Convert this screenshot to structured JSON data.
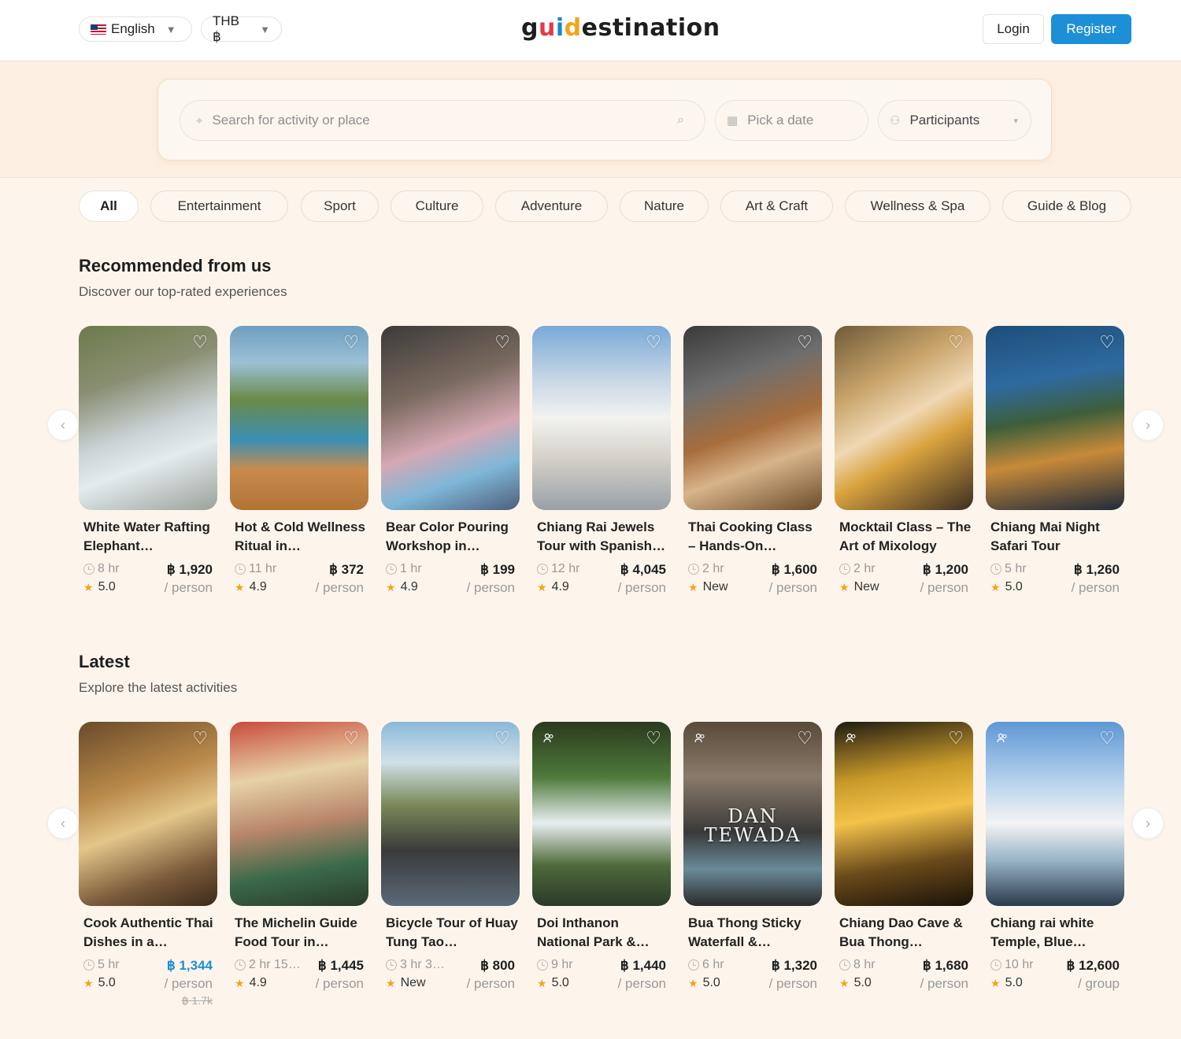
{
  "header": {
    "language": "English",
    "currency": "THB ฿",
    "logo_parts": [
      "g",
      "u",
      "i",
      "d",
      "estination"
    ],
    "login": "Login",
    "register": "Register",
    "brand_color": "#1d8fd6"
  },
  "search": {
    "placeholder": "Search for activity or place",
    "date_placeholder": "Pick a date",
    "participants": "Participants"
  },
  "categories": [
    "All",
    "Entertainment",
    "Sport",
    "Culture",
    "Adventure",
    "Nature",
    "Art & Craft",
    "Wellness & Spa",
    "Guide & Blog"
  ],
  "recommended": {
    "title": "Recommended from us",
    "subtitle": "Discover our top-rated experiences",
    "cards": [
      {
        "title": "White Water Rafting Elephant…",
        "duration": "8 hr",
        "rating": "5.0",
        "price": "฿ 1,920",
        "unit": "/ person"
      },
      {
        "title": "Hot & Cold Wellness Ritual in…",
        "duration": "11 hr",
        "rating": "4.9",
        "price": "฿ 372",
        "unit": "/ person"
      },
      {
        "title": "Bear Color Pouring Workshop in…",
        "duration": "1 hr",
        "rating": "4.9",
        "price": "฿ 199",
        "unit": "/ person"
      },
      {
        "title": "Chiang Rai Jewels Tour with Spanish…",
        "duration": "12 hr",
        "rating": "4.9",
        "price": "฿ 4,045",
        "unit": "/ person"
      },
      {
        "title": "Thai Cooking Class – Hands-On…",
        "duration": "2 hr",
        "rating": "New",
        "price": "฿ 1,600",
        "unit": "/ person"
      },
      {
        "title": "Mocktail Class – The Art of Mixology",
        "duration": "2 hr",
        "rating": "New",
        "price": "฿ 1,200",
        "unit": "/ person"
      },
      {
        "title": "Chiang Mai Night Safari Tour",
        "duration": "5 hr",
        "rating": "5.0",
        "price": "฿ 1,260",
        "unit": "/ person"
      }
    ]
  },
  "latest": {
    "title": "Latest",
    "subtitle": "Explore the latest activities",
    "cards": [
      {
        "title": "Cook Authentic Thai Dishes in a…",
        "duration": "5 hr",
        "rating": "5.0",
        "price": "฿ 1,344",
        "unit": "/ person",
        "old_price": "฿ 1.7k"
      },
      {
        "title": "The Michelin Guide Food Tour in…",
        "duration": "2 hr 15…",
        "rating": "4.9",
        "price": "฿ 1,445",
        "unit": "/ person"
      },
      {
        "title": "Bicycle Tour of Huay Tung Tao…",
        "duration": "3 hr 3…",
        "rating": "New",
        "price": "฿ 800",
        "unit": "/ person"
      },
      {
        "title": "Doi Inthanon National Park &…",
        "duration": "9 hr",
        "rating": "5.0",
        "price": "฿ 1,440",
        "unit": "/ person"
      },
      {
        "title": "Bua Thong Sticky Waterfall &…",
        "duration": "6 hr",
        "rating": "5.0",
        "price": "฿ 1,320",
        "unit": "/ person",
        "image_text": "DAN TEWADA"
      },
      {
        "title": "Chiang Dao Cave & Bua Thong…",
        "duration": "8 hr",
        "rating": "5.0",
        "price": "฿ 1,680",
        "unit": "/ person"
      },
      {
        "title": "Chiang rai white Temple, Blue…",
        "duration": "10 hr",
        "rating": "5.0",
        "price": "฿ 12,600",
        "unit": "/ group"
      }
    ]
  }
}
